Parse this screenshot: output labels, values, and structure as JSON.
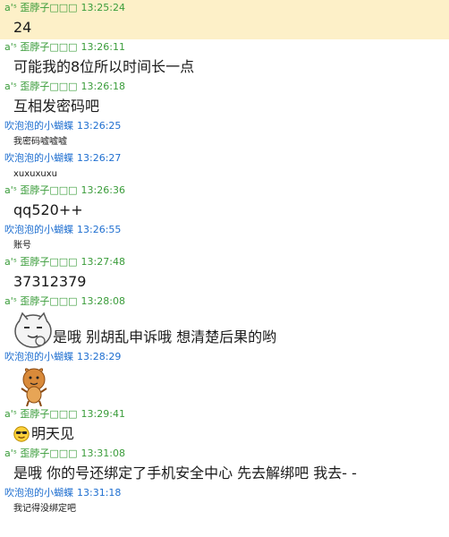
{
  "messages": [
    {
      "sender": "a'ˢ 歪脖子□□□",
      "time": "13:25:24",
      "text": "24"
    },
    {
      "sender": "a'ˢ 歪脖子□□□",
      "time": "13:26:11",
      "text": "可能我的8位所以时间长一点"
    },
    {
      "sender": "a'ˢ 歪脖子□□□",
      "time": "13:26:18",
      "text": "互相发密码吧"
    },
    {
      "sender": "吹泡泡的小蝴蝶",
      "time": "13:26:25",
      "text": "我密码嘘嘘嘘"
    },
    {
      "sender": "吹泡泡的小蝴蝶",
      "time": "13:26:27",
      "text": "xuxuxuxu"
    },
    {
      "sender": "a'ˢ 歪脖子□□□",
      "time": "13:26:36",
      "text": "qq520++"
    },
    {
      "sender": "吹泡泡的小蝴蝶",
      "time": "13:26:55",
      "text": "账号"
    },
    {
      "sender": "a'ˢ 歪脖子□□□",
      "time": "13:27:48",
      "text": "37312379"
    },
    {
      "sender": "a'ˢ 歪脖子□□□",
      "time": "13:28:08",
      "text": "是哦 别胡乱申诉哦 想清楚后果的哟",
      "icon": "thinking-cat-face-icon"
    },
    {
      "sender": "吹泡泡的小蝴蝶",
      "time": "13:28:29",
      "text": "",
      "icon": "dancing-sticker-icon"
    },
    {
      "sender": "a'ˢ 歪脖子□□□",
      "time": "13:29:41",
      "text": "明天见",
      "icon": "sunglasses-smiley-icon"
    },
    {
      "sender": "a'ˢ 歪脖子□□□",
      "time": "13:31:08",
      "text": "是哦 你的号还绑定了手机安全中心 先去解绑吧 我去- -"
    },
    {
      "sender": "吹泡泡的小蝴蝶",
      "time": "13:31:18",
      "text": "我记得没绑定吧"
    }
  ],
  "colors": {
    "sender_a": "#3a9c3a",
    "sender_b": "#1f6fd0",
    "highlight_row": "#fdf0c8"
  }
}
